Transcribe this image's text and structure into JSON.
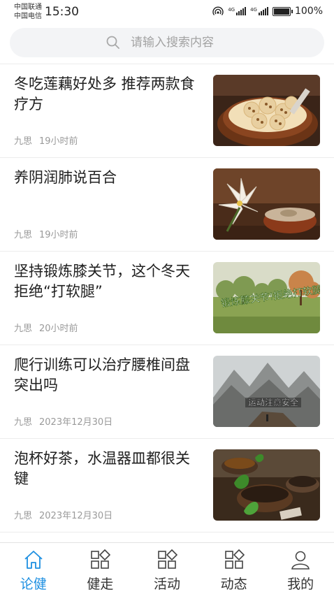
{
  "status_bar": {
    "carrier_1": "中国联通",
    "carrier_2": "中国电信",
    "time": "15:30",
    "sig1_label": "4G",
    "sig2_label": "4G",
    "battery": "100%",
    "battery_level": 1.0
  },
  "search": {
    "placeholder": "请输入搜索内容"
  },
  "articles": [
    {
      "title": "冬吃莲藕好处多 推荐两款食疗方",
      "author": "九思",
      "time": "19小时前",
      "image": "lotus-root-dish"
    },
    {
      "title": "养阴润肺说百合",
      "author": "九思",
      "time": "19小时前",
      "image": "lily-soup"
    },
    {
      "title": "坚持锻炼膝关节，这个冬天拒绝“打软腿”",
      "author": "九思",
      "time": "20小时前",
      "image": "park-exercise",
      "image_text": "锻炼膝关节!拒绝打软腿!"
    },
    {
      "title": "爬行训练可以治疗腰椎间盘突出吗",
      "author": "九思",
      "time": "2023年12月30日",
      "image": "mountain-hiker",
      "image_text": "运动注意安全"
    },
    {
      "title": "泡杯好茶，水温器皿都很关键",
      "author": "九思",
      "time": "2023年12月30日",
      "image": "tea-cups"
    }
  ],
  "nav": [
    {
      "label": "论健",
      "icon": "home-icon",
      "active": true
    },
    {
      "label": "健走",
      "icon": "grid-icon",
      "active": false
    },
    {
      "label": "活动",
      "icon": "grid-icon",
      "active": false
    },
    {
      "label": "动态",
      "icon": "grid-icon",
      "active": false
    },
    {
      "label": "我的",
      "icon": "user-icon",
      "active": false
    }
  ],
  "colors": {
    "accent": "#1d8fe1",
    "text": "#1f1f1f",
    "meta": "#9a9a9a",
    "search_bg": "#f3f4f6"
  }
}
